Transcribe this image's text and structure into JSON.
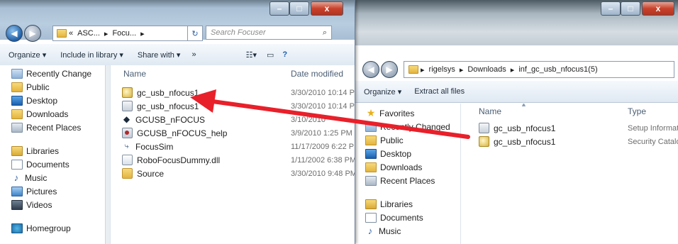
{
  "left_window": {
    "address": {
      "prefix": "«",
      "segments": [
        "ASC...",
        "Focu..."
      ],
      "dropdown": "▾",
      "refresh": "↻"
    },
    "search": {
      "placeholder": "Search Focuser"
    },
    "controls": {
      "minimize": "–",
      "maximize": "□",
      "close": "x"
    },
    "toolbar": {
      "organize": "Organize ▾",
      "include": "Include in library ▾",
      "share": "Share with ▾",
      "more": "»"
    },
    "nav_items": [
      {
        "label": "Recently Change",
        "icon": "recent-changes-icon"
      },
      {
        "label": "Public",
        "icon": "folder-icon"
      },
      {
        "label": "Desktop",
        "icon": "desktop-icon"
      },
      {
        "label": "Downloads",
        "icon": "downloads-icon"
      },
      {
        "label": "Recent Places",
        "icon": "recent-places-icon"
      },
      {
        "label": "",
        "icon": ""
      },
      {
        "label": "Libraries",
        "icon": "libraries-icon"
      },
      {
        "label": "Documents",
        "icon": "documents-icon"
      },
      {
        "label": "Music",
        "icon": "music-icon"
      },
      {
        "label": "Pictures",
        "icon": "pictures-icon"
      },
      {
        "label": "Videos",
        "icon": "videos-icon"
      },
      {
        "label": "",
        "icon": ""
      },
      {
        "label": "Homegroup",
        "icon": "homegroup-icon"
      }
    ],
    "columns": {
      "name": "Name",
      "date": "Date modified"
    },
    "files": [
      {
        "name": "gc_usb_nfocus1",
        "date": "3/30/2010 10:14 P",
        "icon": "security-catalog-icon"
      },
      {
        "name": "gc_usb_nfocus1",
        "date": "3/30/2010 10:14 P",
        "icon": "setup-information-icon"
      },
      {
        "name": "GCUSB_nFOCUS",
        "date": "3/10/2010",
        "icon": "application-icon"
      },
      {
        "name": "GCUSB_nFOCUS_help",
        "date": "3/9/2010 1:25 PM",
        "icon": "help-file-icon"
      },
      {
        "name": "FocusSim",
        "date": "11/17/2009 6:22 P",
        "icon": "shortcut-icon"
      },
      {
        "name": "RoboFocusDummy.dll",
        "date": "1/11/2002 6:38 PM",
        "icon": "dll-file-icon"
      },
      {
        "name": "Source",
        "date": "3/30/2010 9:48 PM",
        "icon": "folder-icon"
      }
    ]
  },
  "right_window": {
    "controls": {
      "minimize": "–",
      "maximize": "□",
      "close": "x"
    },
    "address": {
      "segments": [
        "rigelsys",
        "Downloads",
        "inf_gc_usb_nfocus1(5)"
      ]
    },
    "toolbar": {
      "organize": "Organize ▾",
      "extract": "Extract all files"
    },
    "nav_items": [
      {
        "label": "Favorites",
        "icon": "favorites-icon"
      },
      {
        "label": "Recently Changed",
        "icon": "recent-changes-icon"
      },
      {
        "label": "Public",
        "icon": "folder-icon"
      },
      {
        "label": "Desktop",
        "icon": "desktop-icon"
      },
      {
        "label": "Downloads",
        "icon": "downloads-icon"
      },
      {
        "label": "Recent Places",
        "icon": "recent-places-icon"
      },
      {
        "label": "",
        "icon": ""
      },
      {
        "label": "Libraries",
        "icon": "libraries-icon"
      },
      {
        "label": "Documents",
        "icon": "documents-icon"
      },
      {
        "label": "Music",
        "icon": "music-icon"
      }
    ],
    "columns": {
      "name": "Name",
      "type": "Type"
    },
    "files": [
      {
        "name": "gc_usb_nfocus1",
        "type": "Setup Informati",
        "icon": "setup-information-icon"
      },
      {
        "name": "gc_usb_nfocus1",
        "type": "Security Catalog",
        "icon": "security-catalog-icon"
      }
    ]
  },
  "annotation": {
    "color": "#e8202a",
    "meaning": "drag-arrow"
  }
}
